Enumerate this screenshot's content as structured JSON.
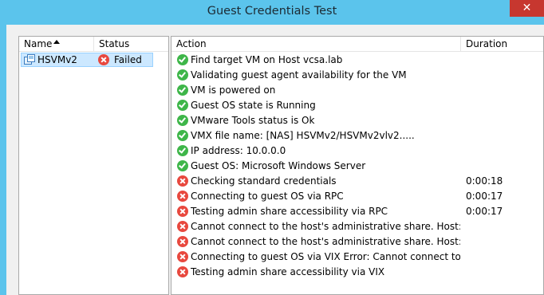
{
  "window": {
    "title": "Guest Credentials Test",
    "close_glyph": "✕"
  },
  "left": {
    "columns": {
      "name": "Name",
      "status": "Status"
    },
    "vms": [
      {
        "name": "HSVMv2",
        "status": "Failed",
        "status_icon": "fail-icon"
      }
    ]
  },
  "right": {
    "columns": {
      "action": "Action",
      "duration": "Duration"
    },
    "rows": [
      {
        "status": "ok",
        "action": "Find target VM on Host  vcsa.lab",
        "duration": ""
      },
      {
        "status": "ok",
        "action": "Validating guest agent availability for the VM",
        "duration": ""
      },
      {
        "status": "ok",
        "action": "VM is powered on",
        "duration": ""
      },
      {
        "status": "ok",
        "action": "Guest OS state is Running",
        "duration": ""
      },
      {
        "status": "ok",
        "action": "VMware Tools status is Ok",
        "duration": ""
      },
      {
        "status": "ok",
        "action": "VMX file name: [NAS] HSVMv2/HSVMv2vlv2.....",
        "duration": ""
      },
      {
        "status": "ok",
        "action": "IP address: 10.0.0.0",
        "duration": ""
      },
      {
        "status": "ok",
        "action": "Guest OS: Microsoft Windows Server",
        "duration": ""
      },
      {
        "status": "fail",
        "action": "Checking standard credentials",
        "duration": "0:00:18"
      },
      {
        "status": "fail",
        "action": "Connecting to guest OS via RPC",
        "duration": "0:00:17"
      },
      {
        "status": "fail",
        "action": "Testing admin share accessibility via RPC",
        "duration": "0:00:17"
      },
      {
        "status": "fail",
        "action": "Cannot connect to the host's administrative share. Host:",
        "duration": ""
      },
      {
        "status": "fail",
        "action": "Cannot connect to the host's administrative share. Host:",
        "duration": ""
      },
      {
        "status": "fail",
        "action": "Connecting to guest OS via VIX Error: Cannot connect to host ...",
        "duration": ""
      },
      {
        "status": "fail",
        "action": "Testing admin share accessibility via VIX",
        "duration": ""
      }
    ]
  },
  "colors": {
    "titlebar": "#5bc4ec",
    "close": "#c7372f",
    "ok": "#3eb649",
    "fail": "#e8483e",
    "selection": "#cce8ff"
  }
}
